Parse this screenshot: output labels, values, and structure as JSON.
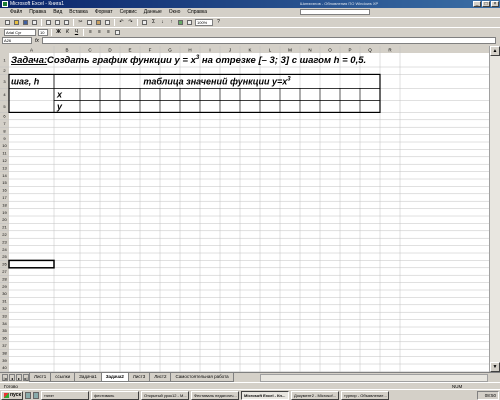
{
  "window": {
    "title": "Microsoft Excel - Книга1",
    "title_right": "Шинэхэнов - Обновления ПО Windows XP"
  },
  "menu": [
    "Файл",
    "Правка",
    "Вид",
    "Вставка",
    "Формат",
    "Сервис",
    "Данные",
    "Окно",
    "Справка"
  ],
  "format_toolbar": {
    "font": "Arial Cyr",
    "size": "10",
    "zoom": "100%"
  },
  "formula_bar": {
    "name_box": "A26",
    "fx": "fx",
    "value": ""
  },
  "columns": [
    "A",
    "B",
    "C",
    "D",
    "E",
    "F",
    "G",
    "H",
    "I",
    "J",
    "K",
    "L",
    "M",
    "N",
    "O",
    "P",
    "Q",
    "R"
  ],
  "rows": [
    "1",
    "2",
    "3",
    "4",
    "5",
    "6",
    "7",
    "8",
    "9",
    "10",
    "11",
    "12",
    "13",
    "14",
    "15",
    "16",
    "17",
    "18",
    "19",
    "20",
    "21",
    "22",
    "23",
    "24",
    "25",
    "26",
    "27",
    "28",
    "29",
    "30",
    "31",
    "32",
    "33",
    "34",
    "35",
    "36",
    "37",
    "38",
    "39",
    "40"
  ],
  "cells": {
    "task_label": "Задача:",
    "task_text_a": "Создать график функции y = x",
    "task_exp": "3",
    "task_text_b": " на отрезке [– 3; 3] с шагом h = 0,5.",
    "step_header": "шаг, h",
    "table_header_a": "таблица значений функции y=x",
    "table_header_exp": "3",
    "row_x": "x",
    "row_y": "y"
  },
  "sheet_tabs": {
    "items": [
      "Лист1",
      "ссылки",
      "Задача1",
      "Задача2",
      "Лист3",
      "Лист2",
      "Самостоятельная работа"
    ],
    "active": "Задача2"
  },
  "status": {
    "left": "Готово",
    "right": "NUM"
  },
  "taskbar": {
    "start_label": "пуск",
    "items": [
      "тэлэт",
      "фестиваль",
      "Открытый урок12 - М...",
      "Фестиваль педагогич...",
      "Microsoft Excel - Кн...",
      "Документ2 - Microsof...",
      "турнир - Объявление..."
    ],
    "active_index": 4,
    "clock": "08:50"
  }
}
